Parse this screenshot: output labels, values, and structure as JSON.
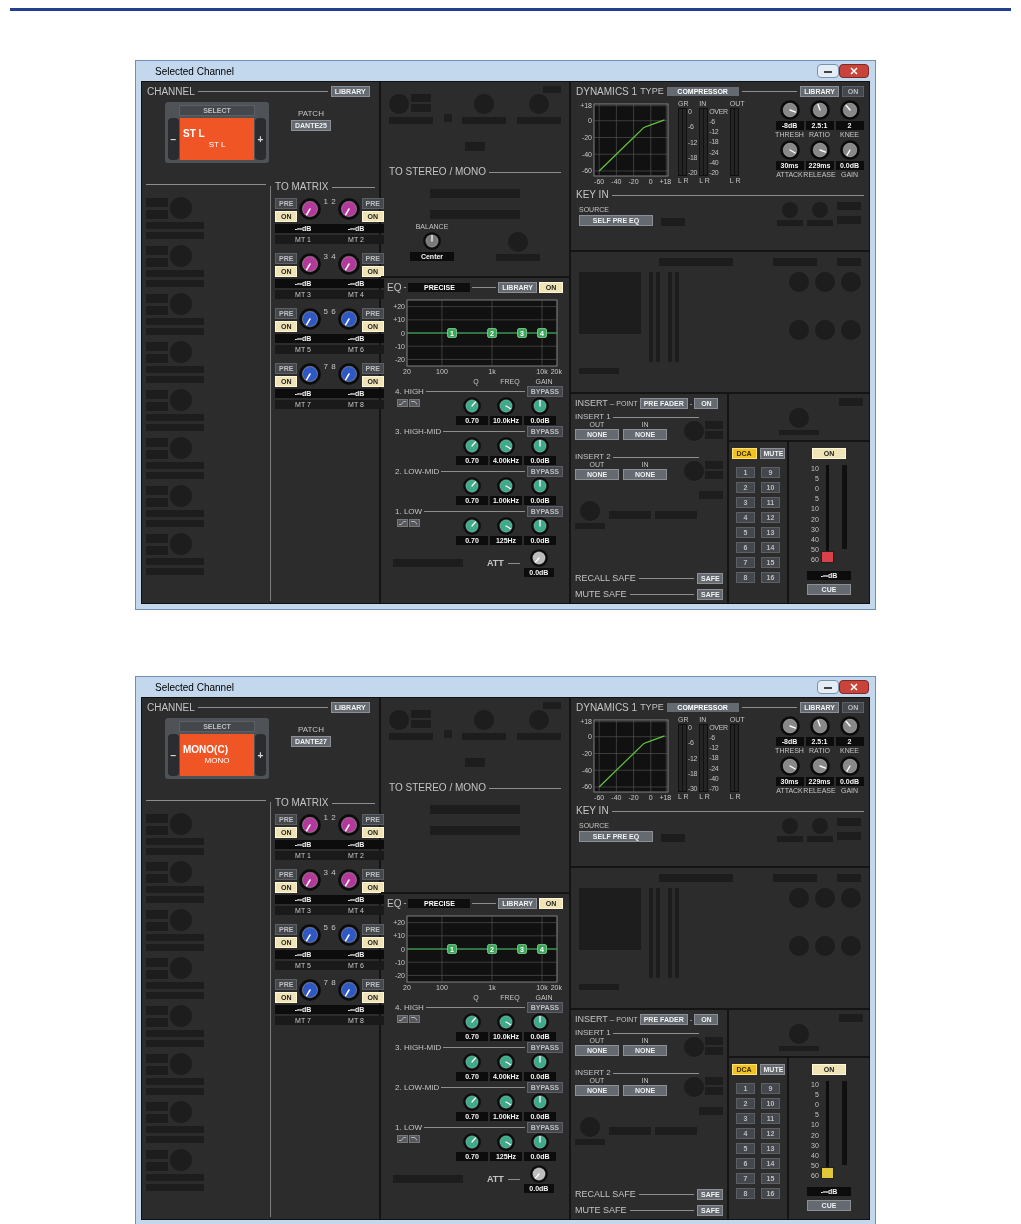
{
  "windows": [
    {
      "title": "Selected Channel",
      "channel": {
        "heading": "CHANNEL",
        "library": "LIBRARY",
        "select": "SELECT",
        "minus": "−",
        "plus": "+",
        "name": "ST L",
        "short_name": "ST L",
        "patch_label": "PATCH",
        "patch": "DANTE25"
      },
      "matrix": {
        "heading": "TO MATRIX",
        "sends": [
          {
            "number": "1",
            "pre": {
              "label": "PRE",
              "on": false
            },
            "on": {
              "label": "ON",
              "on": true
            },
            "level": "-∞dB",
            "name": "MT 1",
            "color": "#b2389a"
          },
          {
            "number": "2",
            "pre": {
              "label": "PRE",
              "on": false
            },
            "on": {
              "label": "ON",
              "on": true
            },
            "level": "-∞dB",
            "name": "MT 2",
            "color": "#b2389a"
          },
          {
            "number": "3",
            "pre": {
              "label": "PRE",
              "on": false
            },
            "on": {
              "label": "ON",
              "on": true
            },
            "level": "-∞dB",
            "name": "MT 3",
            "color": "#b2389a"
          },
          {
            "number": "4",
            "pre": {
              "label": "PRE",
              "on": false
            },
            "on": {
              "label": "ON",
              "on": true
            },
            "level": "-∞dB",
            "name": "MT 4",
            "color": "#b2389a"
          },
          {
            "number": "5",
            "pre": {
              "label": "PRE",
              "on": false
            },
            "on": {
              "label": "ON",
              "on": true
            },
            "level": "-∞dB",
            "name": "MT 5",
            "color": "#2f58c4"
          },
          {
            "number": "6",
            "pre": {
              "label": "PRE",
              "on": false
            },
            "on": {
              "label": "ON",
              "on": true
            },
            "level": "-∞dB",
            "name": "MT 6",
            "color": "#2f58c4"
          },
          {
            "number": "7",
            "pre": {
              "label": "PRE",
              "on": false
            },
            "on": {
              "label": "ON",
              "on": true
            },
            "level": "-∞dB",
            "name": "MT 7",
            "color": "#2f58c4"
          },
          {
            "number": "8",
            "pre": {
              "label": "PRE",
              "on": false
            },
            "on": {
              "label": "ON",
              "on": true
            },
            "level": "-∞dB",
            "name": "MT 8",
            "color": "#2f58c4"
          }
        ]
      },
      "stereo": {
        "heading": "TO STEREO / MONO",
        "balance": {
          "label": "BALANCE",
          "value": "Center"
        }
      },
      "eq": {
        "label": "EQ",
        "dash": "-",
        "type": "PRECISE",
        "library": "LIBRARY",
        "on": {
          "label": "ON",
          "on": true
        },
        "graph": {
          "y_labels": [
            "+20",
            "+10",
            "0",
            "-10",
            "-20"
          ],
          "x_labels": [
            "20",
            "100",
            "1k",
            "10k",
            "20k"
          ],
          "band_markers": [
            "1",
            "2",
            "3",
            "4"
          ]
        },
        "columns": [
          "Q",
          "FREQ",
          "GAIN"
        ],
        "bands": [
          {
            "kind": "shelf",
            "name": "4. HIGH",
            "bypass": "BYPASS",
            "q": "0.70",
            "freq": "10.0kHz",
            "gain": "0.0dB"
          },
          {
            "kind": "peak",
            "name": "3. HIGH-MID",
            "bypass": "BYPASS",
            "q": "0.70",
            "freq": "4.00kHz",
            "gain": "0.0dB"
          },
          {
            "kind": "peak",
            "name": "2. LOW-MID",
            "bypass": "BYPASS",
            "q": "0.70",
            "freq": "1.00kHz",
            "gain": "0.0dB"
          },
          {
            "kind": "shelf",
            "name": "1. LOW",
            "bypass": "BYPASS",
            "q": "0.70",
            "freq": "125Hz",
            "gain": "0.0dB"
          }
        ],
        "att": {
          "label": "ATT",
          "value": "0.0dB"
        }
      },
      "dynamics": {
        "label": "DYNAMICS 1",
        "type_label": "TYPE",
        "type": "COMPRESSOR",
        "library": "LIBRARY",
        "on": {
          "label": "ON",
          "on": false
        },
        "chart_data": {
          "type": "line",
          "grid": true,
          "x": [
            -60,
            -20,
            -8,
            0,
            16
          ],
          "series": [
            {
              "color": "#5fc43c",
              "values": [
                -60,
                -20,
                -8,
                -5,
                1
              ]
            }
          ],
          "xlim": [
            -66,
            20
          ],
          "ylim": [
            -66,
            20
          ],
          "xticks": [
            -60,
            -40,
            -20,
            0,
            {
              "value": 18,
              "label": "+18"
            }
          ],
          "yticks": [
            {
              "value": 18,
              "label": "+18"
            },
            0,
            -20,
            -40,
            -60
          ]
        },
        "meters": [
          {
            "label": "GR",
            "channels": "L R",
            "scale": [
              "0",
              "-6",
              "-12",
              "-18",
              "-20"
            ]
          },
          {
            "label": "IN",
            "channels": "L R",
            "scale": [
              "OVER",
              "-6",
              "-12",
              "-18",
              "-24",
              "-40",
              "-20"
            ]
          },
          {
            "label": "OUT",
            "channels": "L R"
          }
        ],
        "params": [
          {
            "label": "THRESH",
            "value": "-8dB"
          },
          {
            "label": "RATIO",
            "value": "2.5:1"
          },
          {
            "label": "KNEE",
            "value": "2"
          },
          {
            "label": "ATTACK",
            "value": "30ms"
          },
          {
            "label": "RELEASE",
            "value": "229ms"
          },
          {
            "label": "GAIN",
            "value": "0.0dB"
          }
        ]
      },
      "key_in": {
        "heading": "KEY IN",
        "source_label": "SOURCE",
        "source": "SELF PRE EQ"
      },
      "insert": {
        "label": "INSERT",
        "dash": "–",
        "point_label": "POINT",
        "point": "PRE FADER",
        "dash2": "-",
        "on": {
          "label": "ON",
          "on": false
        },
        "slots": [
          {
            "heading": "INSERT 1",
            "out_label": "OUT",
            "out": "NONE",
            "in_label": "IN",
            "in": "NONE"
          },
          {
            "heading": "INSERT 2",
            "out_label": "OUT",
            "out": "NONE",
            "in_label": "IN",
            "in": "NONE"
          }
        ]
      },
      "safe": [
        {
          "label": "RECALL SAFE",
          "button": "SAFE"
        },
        {
          "label": "MUTE SAFE",
          "button": "SAFE"
        }
      ],
      "dca": {
        "tabs": [
          {
            "label": "DCA",
            "selected": true
          },
          {
            "label": "MUTE",
            "selected": false
          }
        ],
        "groups": [
          "1",
          "2",
          "3",
          "4",
          "5",
          "6",
          "7",
          "8",
          "9",
          "10",
          "11",
          "12",
          "13",
          "14",
          "15",
          "16"
        ]
      },
      "fader": {
        "on": {
          "label": "ON",
          "on": true
        },
        "scale": [
          "10",
          "5",
          "0",
          "5",
          "10",
          "20",
          "30",
          "40",
          "50",
          "60"
        ],
        "level": 0,
        "color": "#d8404a",
        "value": "-∞dB",
        "cue": "CUE"
      }
    },
    {
      "title": "Selected Channel",
      "channel": {
        "heading": "CHANNEL",
        "library": "LIBRARY",
        "select": "SELECT",
        "minus": "−",
        "plus": "+",
        "name": "MONO(C)",
        "short_name": "MONO",
        "patch_label": "PATCH",
        "patch": "DANTE27"
      },
      "matrix": {
        "heading": "TO MATRIX",
        "sends": [
          {
            "number": "1",
            "pre": {
              "label": "PRE",
              "on": false
            },
            "on": {
              "label": "ON",
              "on": true
            },
            "level": "-∞dB",
            "name": "MT 1",
            "color": "#b2389a"
          },
          {
            "number": "2",
            "pre": {
              "label": "PRE",
              "on": false
            },
            "on": {
              "label": "ON",
              "on": true
            },
            "level": "-∞dB",
            "name": "MT 2",
            "color": "#b2389a"
          },
          {
            "number": "3",
            "pre": {
              "label": "PRE",
              "on": false
            },
            "on": {
              "label": "ON",
              "on": true
            },
            "level": "-∞dB",
            "name": "MT 3",
            "color": "#b2389a"
          },
          {
            "number": "4",
            "pre": {
              "label": "PRE",
              "on": false
            },
            "on": {
              "label": "ON",
              "on": true
            },
            "level": "-∞dB",
            "name": "MT 4",
            "color": "#b2389a"
          },
          {
            "number": "5",
            "pre": {
              "label": "PRE",
              "on": false
            },
            "on": {
              "label": "ON",
              "on": true
            },
            "level": "-∞dB",
            "name": "MT 5",
            "color": "#2f58c4"
          },
          {
            "number": "6",
            "pre": {
              "label": "PRE",
              "on": false
            },
            "on": {
              "label": "ON",
              "on": true
            },
            "level": "-∞dB",
            "name": "MT 6",
            "color": "#2f58c4"
          },
          {
            "number": "7",
            "pre": {
              "label": "PRE",
              "on": false
            },
            "on": {
              "label": "ON",
              "on": true
            },
            "level": "-∞dB",
            "name": "MT 7",
            "color": "#2f58c4"
          },
          {
            "number": "8",
            "pre": {
              "label": "PRE",
              "on": false
            },
            "on": {
              "label": "ON",
              "on": true
            },
            "level": "-∞dB",
            "name": "MT 8",
            "color": "#2f58c4"
          }
        ]
      },
      "stereo": {
        "heading": "TO STEREO / MONO"
      },
      "eq": {
        "label": "EQ",
        "dash": "-",
        "type": "PRECISE",
        "library": "LIBRARY",
        "on": {
          "label": "ON",
          "on": true
        },
        "graph": {
          "y_labels": [
            "+20",
            "+10",
            "0",
            "-10",
            "-20"
          ],
          "x_labels": [
            "20",
            "100",
            "1k",
            "10k",
            "20k"
          ],
          "band_markers": [
            "1",
            "2",
            "3",
            "4"
          ]
        },
        "columns": [
          "Q",
          "FREQ",
          "GAIN"
        ],
        "bands": [
          {
            "kind": "shelf",
            "name": "4. HIGH",
            "bypass": "BYPASS",
            "q": "0.70",
            "freq": "10.0kHz",
            "gain": "0.0dB"
          },
          {
            "kind": "peak",
            "name": "3. HIGH-MID",
            "bypass": "BYPASS",
            "q": "0.70",
            "freq": "4.00kHz",
            "gain": "0.0dB"
          },
          {
            "kind": "peak",
            "name": "2. LOW-MID",
            "bypass": "BYPASS",
            "q": "0.70",
            "freq": "1.00kHz",
            "gain": "0.0dB"
          },
          {
            "kind": "shelf",
            "name": "1. LOW",
            "bypass": "BYPASS",
            "q": "0.70",
            "freq": "125Hz",
            "gain": "0.0dB"
          }
        ],
        "att": {
          "label": "ATT",
          "value": "0.0dB"
        }
      },
      "dynamics": {
        "label": "DYNAMICS 1",
        "type_label": "TYPE",
        "type": "COMPRESSOR",
        "library": "LIBRARY",
        "on": {
          "label": "ON",
          "on": false
        },
        "chart_data": {
          "type": "line",
          "grid": true,
          "x": [
            -60,
            -20,
            -8,
            0,
            16
          ],
          "series": [
            {
              "color": "#5fc43c",
              "values": [
                -60,
                -20,
                -8,
                -5,
                1
              ]
            }
          ],
          "xlim": [
            -66,
            20
          ],
          "ylim": [
            -66,
            20
          ],
          "xticks": [
            -60,
            -40,
            -20,
            0,
            {
              "value": 18,
              "label": "+18"
            }
          ],
          "yticks": [
            {
              "value": 18,
              "label": "+18"
            },
            0,
            -20,
            -40,
            -60
          ]
        },
        "meters": [
          {
            "label": "GR",
            "channels": "L R",
            "scale": [
              "0",
              "-6",
              "-12",
              "-18",
              "-30"
            ]
          },
          {
            "label": "IN",
            "channels": "L R",
            "scale": [
              "OVER",
              "-6",
              "-12",
              "-18",
              "-24",
              "-40",
              "-70"
            ]
          },
          {
            "label": "OUT",
            "channels": "L R"
          }
        ],
        "params": [
          {
            "label": "THRESH",
            "value": "-8dB"
          },
          {
            "label": "RATIO",
            "value": "2.5:1"
          },
          {
            "label": "KNEE",
            "value": "2"
          },
          {
            "label": "ATTACK",
            "value": "30ms"
          },
          {
            "label": "RELEASE",
            "value": "229ms"
          },
          {
            "label": "GAIN",
            "value": "0.0dB"
          }
        ]
      },
      "key_in": {
        "heading": "KEY IN",
        "source_label": "SOURCE",
        "source": "SELF PRE EQ"
      },
      "insert": {
        "label": "INSERT",
        "dash": "–",
        "point_label": "POINT",
        "point": "PRE FADER",
        "dash2": "-",
        "on": {
          "label": "ON",
          "on": false
        },
        "slots": [
          {
            "heading": "INSERT 1",
            "out_label": "OUT",
            "out": "NONE",
            "in_label": "IN",
            "in": "NONE"
          },
          {
            "heading": "INSERT 2",
            "out_label": "OUT",
            "out": "NONE",
            "in_label": "IN",
            "in": "NONE"
          }
        ]
      },
      "safe": [
        {
          "label": "RECALL SAFE",
          "button": "SAFE"
        },
        {
          "label": "MUTE SAFE",
          "button": "SAFE"
        }
      ],
      "dca": {
        "tabs": [
          {
            "label": "DCA",
            "selected": true
          },
          {
            "label": "MUTE",
            "selected": false
          }
        ],
        "groups": [
          "1",
          "2",
          "3",
          "4",
          "5",
          "6",
          "7",
          "8",
          "9",
          "10",
          "11",
          "12",
          "13",
          "14",
          "15",
          "16"
        ]
      },
      "fader": {
        "on": {
          "label": "ON",
          "on": true
        },
        "scale": [
          "10",
          "5",
          "0",
          "5",
          "10",
          "20",
          "30",
          "40",
          "50",
          "60"
        ],
        "level": 0,
        "color": "#e0c83a",
        "value": "-∞dB",
        "cue": "CUE"
      }
    }
  ]
}
